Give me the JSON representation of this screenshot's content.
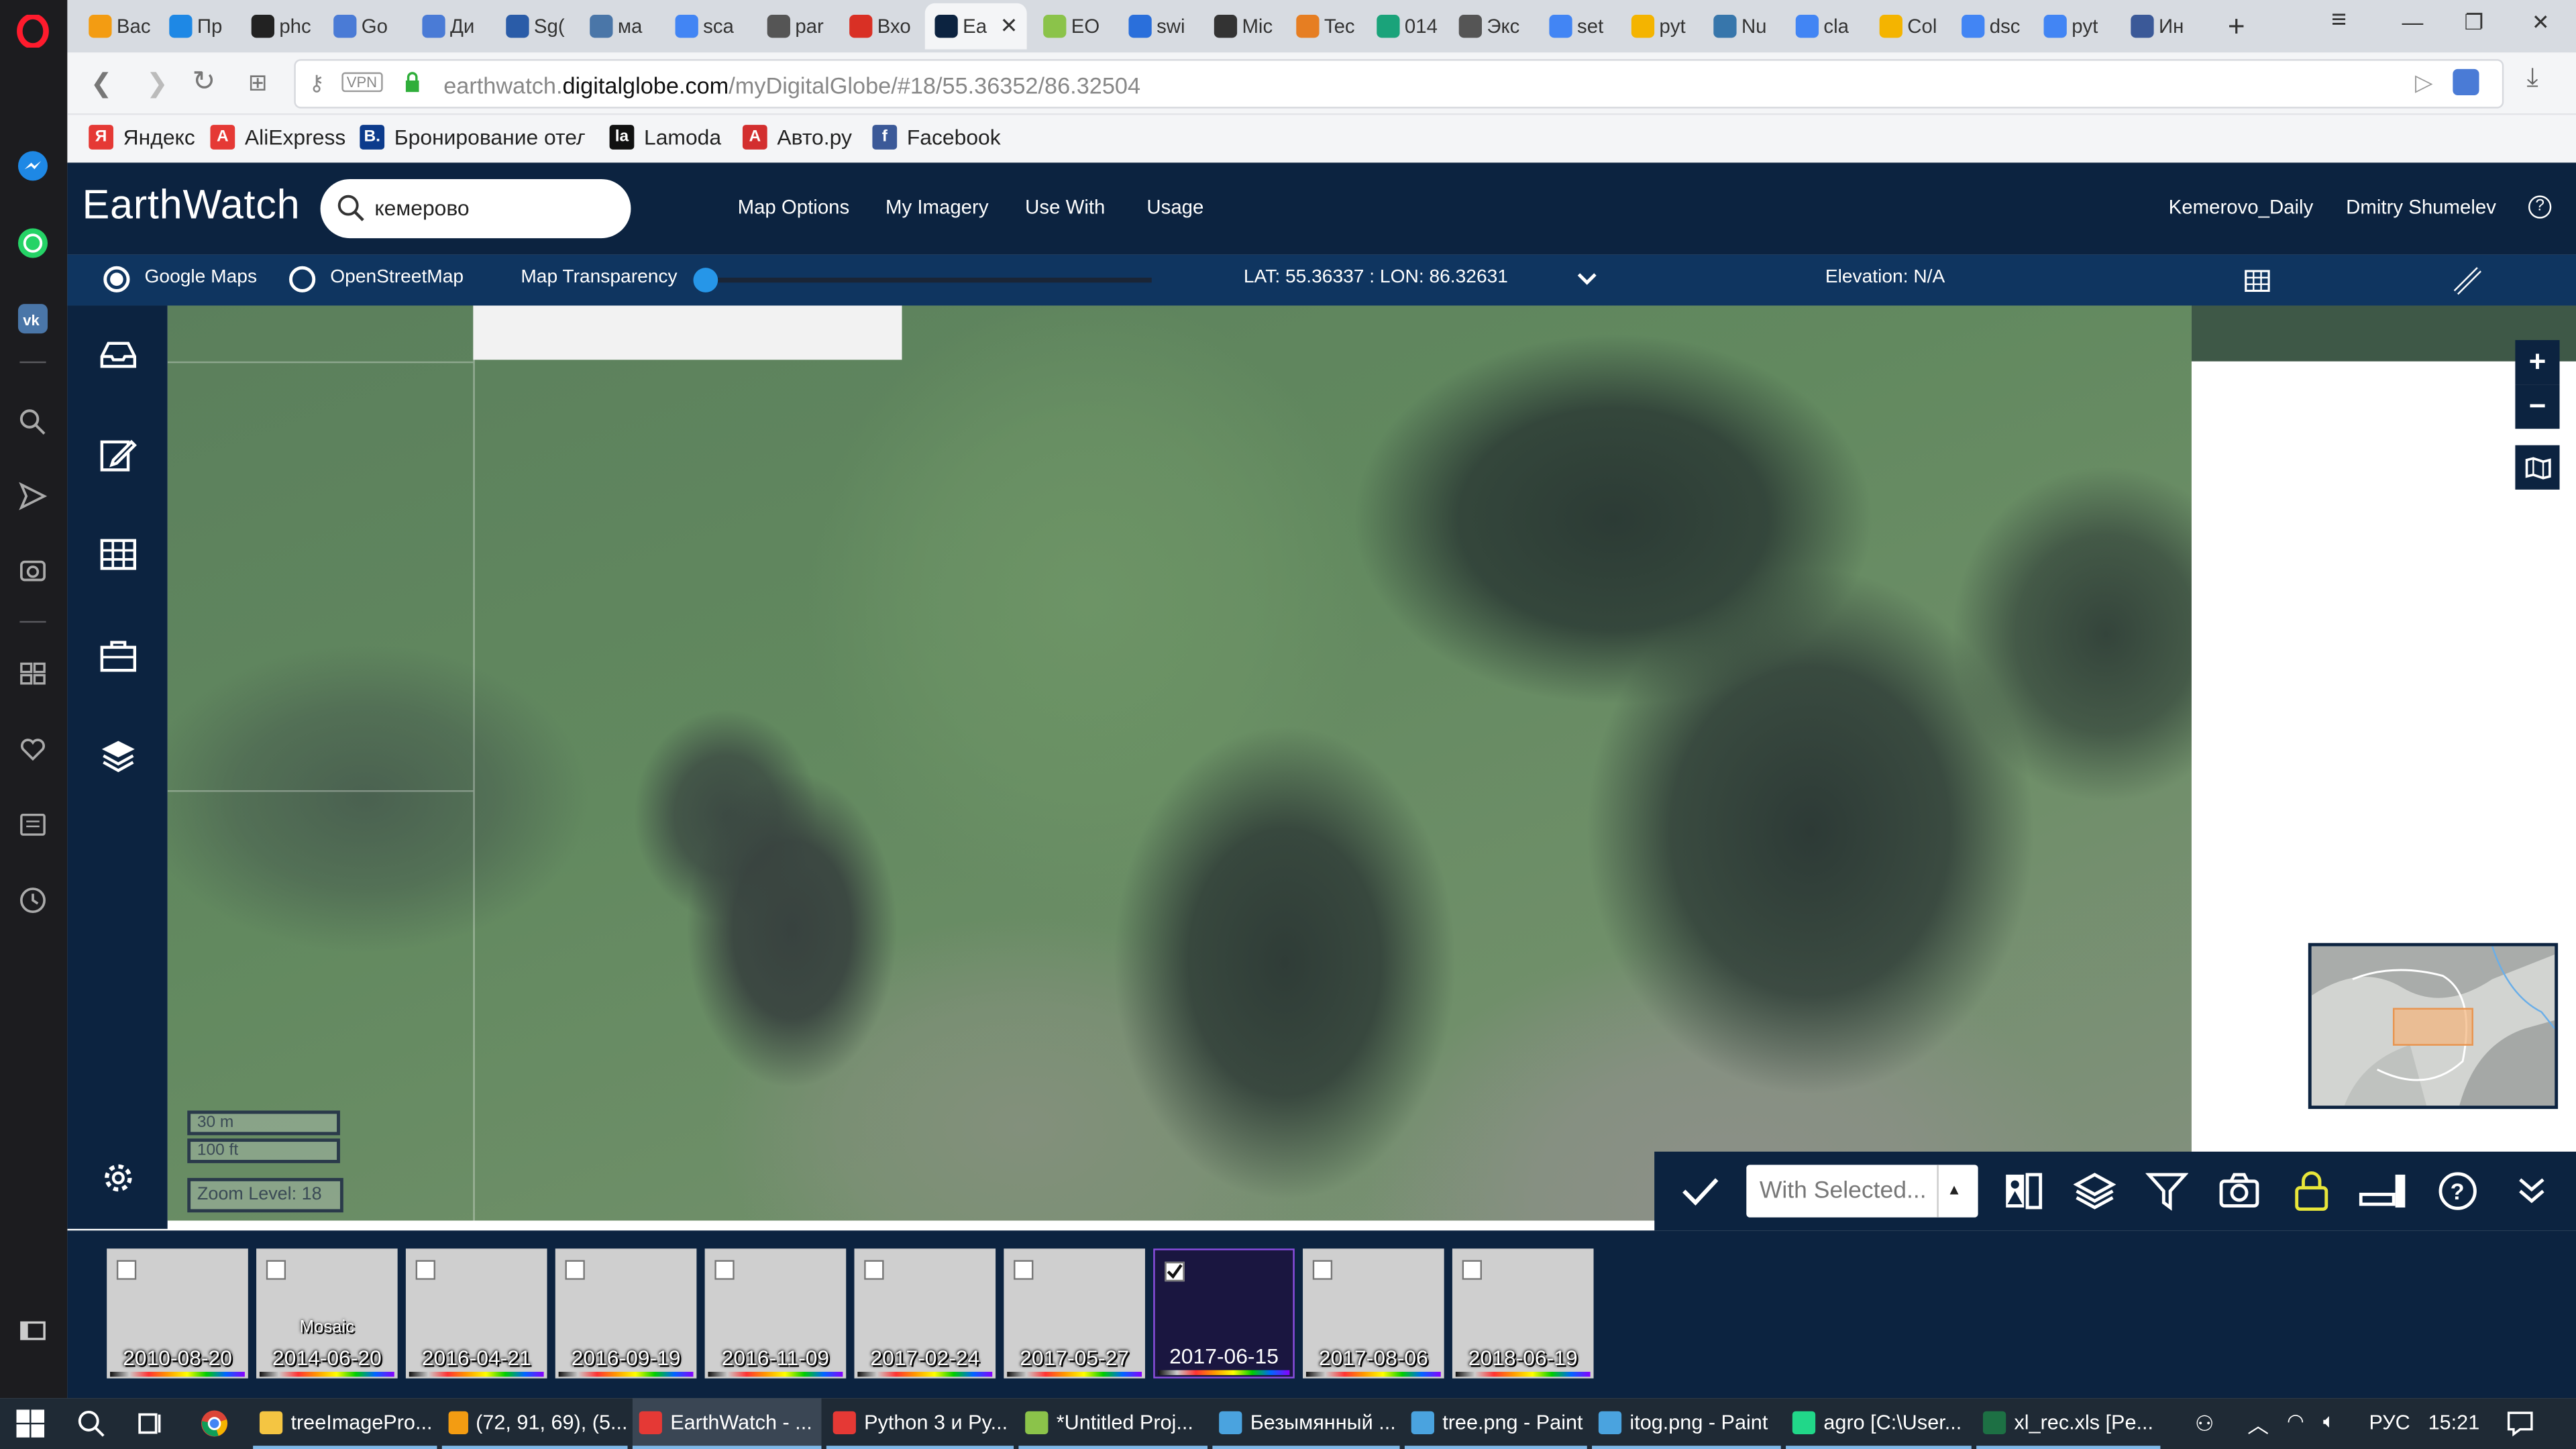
{
  "browser": {
    "tabs": [
      {
        "label": "Bac",
        "color": "#f39c12"
      },
      {
        "label": "Пр",
        "color": "#1e88e5"
      },
      {
        "label": "phc",
        "color": "#222222"
      },
      {
        "label": "Go",
        "color": "#4a7bd6"
      },
      {
        "label": "Ди",
        "color": "#4a7bd6"
      },
      {
        "label": "Sg(",
        "color": "#2a5ca8"
      },
      {
        "label": "ма",
        "color": "#4a76a8"
      },
      {
        "label": "sca",
        "color": "#4285f4"
      },
      {
        "label": "par",
        "color": "#555555"
      },
      {
        "label": "Вхо",
        "color": "#d93025"
      },
      {
        "label": "Ea",
        "color": "#0c2340",
        "active": true
      },
      {
        "label": "EO",
        "color": "#8bc34a"
      },
      {
        "label": "swi",
        "color": "#2a6fdb"
      },
      {
        "label": "Mic",
        "color": "#333333"
      },
      {
        "label": "Tec",
        "color": "#e67e22"
      },
      {
        "label": "014",
        "color": "#1aa37a"
      },
      {
        "label": "Экс",
        "color": "#555555"
      },
      {
        "label": "set",
        "color": "#4285f4"
      },
      {
        "label": "pyt",
        "color": "#f4b400"
      },
      {
        "label": "Nu",
        "color": "#3776ab"
      },
      {
        "label": "cla",
        "color": "#4285f4"
      },
      {
        "label": "Col",
        "color": "#f4b400"
      },
      {
        "label": "dsc",
        "color": "#4285f4"
      },
      {
        "label": "pyt",
        "color": "#4285f4"
      },
      {
        "label": "Ин",
        "color": "#3b5998"
      }
    ],
    "new_tab": "+",
    "url_prefix": "earthwatch.",
    "url_domain": "digitalglobe.com",
    "url_path": "/myDigitalGlobe/#18/55.36352/86.32504",
    "vpn_label": "VPN",
    "bookmarks": [
      {
        "label": "Яндекс",
        "icon_text": "Я",
        "color": "#e53935"
      },
      {
        "label": "AliExpress",
        "icon_text": "A",
        "color": "#e53935"
      },
      {
        "label": "Бронирование отел",
        "icon_text": "B.",
        "color": "#0c3b8c"
      },
      {
        "label": "Lamoda",
        "icon_text": "la",
        "color": "#111111"
      },
      {
        "label": "Авто.ру",
        "icon_text": "A",
        "color": "#d32f2f"
      },
      {
        "label": "Facebook",
        "icon_text": "f",
        "color": "#3b5998"
      }
    ]
  },
  "app": {
    "logo": "EarthWatch",
    "search_value": "кемерово",
    "menu": [
      "Map Options",
      "My Imagery",
      "Use With",
      "Usage"
    ],
    "project": "Kemerovo_Daily",
    "user": "Dmitry Shumelev",
    "help": "?"
  },
  "options": {
    "google_maps": "Google Maps",
    "osm": "OpenStreetMap",
    "transparency": "Map Transparency",
    "transparency_value": 0,
    "latlon": "LAT: 55.36337 : LON: 86.32631",
    "elevation": "Elevation: N/A"
  },
  "map": {
    "scale_m": "30 m",
    "scale_ft": "100 ft",
    "zoom": "Zoom Level: 18",
    "zoom_in": "+",
    "zoom_out": "−"
  },
  "toolbar": {
    "with_selected": "With Selected...",
    "with_selected_arrow": "▲"
  },
  "timeline": [
    {
      "date": "2010-08-20",
      "checked": false,
      "mosaic": ""
    },
    {
      "date": "2014-06-20",
      "checked": false,
      "mosaic": "Mosaic"
    },
    {
      "date": "2016-04-21",
      "checked": false,
      "mosaic": ""
    },
    {
      "date": "2016-09-19",
      "checked": false,
      "mosaic": ""
    },
    {
      "date": "2016-11-09",
      "checked": false,
      "mosaic": ""
    },
    {
      "date": "2017-02-24",
      "checked": false,
      "mosaic": ""
    },
    {
      "date": "2017-05-27",
      "checked": false,
      "mosaic": ""
    },
    {
      "date": "2017-06-15",
      "checked": true,
      "mosaic": ""
    },
    {
      "date": "2017-08-06",
      "checked": false,
      "mosaic": ""
    },
    {
      "date": "2018-06-19",
      "checked": false,
      "mosaic": ""
    }
  ],
  "taskbar": {
    "items": [
      {
        "label": "treeImagePro...",
        "color": "#f4c542"
      },
      {
        "label": "(72, 91, 69), (5...",
        "color": "#f39c12"
      },
      {
        "label": "EarthWatch - ...",
        "color": "#e53935",
        "active": true
      },
      {
        "label": "Python 3 и Py...",
        "color": "#e53935"
      },
      {
        "label": "*Untitled Proj...",
        "color": "#8bc34a"
      },
      {
        "label": "Безымянный ...",
        "color": "#4aa3df"
      },
      {
        "label": "tree.png - Paint",
        "color": "#4aa3df"
      },
      {
        "label": "itog.png - Paint",
        "color": "#4aa3df"
      },
      {
        "label": "agro [C:\\User...",
        "color": "#21d789"
      },
      {
        "label": "xl_rec.xls  [Pe...",
        "color": "#1d7044"
      }
    ],
    "lang": "РУС",
    "time": "15:21"
  }
}
